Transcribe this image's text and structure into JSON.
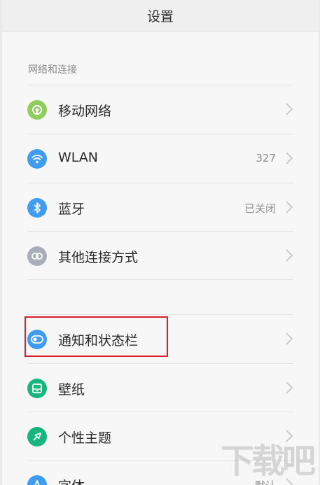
{
  "title": "设置",
  "sections": {
    "network_header": "网络和连接"
  },
  "items": [
    {
      "label": "移动网络",
      "value": "",
      "icon": "mobile-network-icon",
      "color": "#8fcd5c"
    },
    {
      "label": "WLAN",
      "value": "327",
      "icon": "wifi-icon",
      "color": "#3f9cf1"
    },
    {
      "label": "蓝牙",
      "value": "已关闭",
      "icon": "bluetooth-icon",
      "color": "#3f9cf1"
    },
    {
      "label": "其他连接方式",
      "value": "",
      "icon": "link-icon",
      "color": "#a7aeb7"
    },
    {
      "label": "通知和状态栏",
      "value": "",
      "icon": "toggle-icon",
      "color": "#3f9cf1"
    },
    {
      "label": "壁纸",
      "value": "",
      "icon": "wallpaper-icon",
      "color": "#17b67c"
    },
    {
      "label": "个性主题",
      "value": "",
      "icon": "theme-brush-icon",
      "color": "#17b67c"
    },
    {
      "label": "字体",
      "value": "默认",
      "icon": "font-icon",
      "color": "#3f9cf1"
    }
  ],
  "watermark": "下载吧",
  "highlight_color": "#d7202a"
}
